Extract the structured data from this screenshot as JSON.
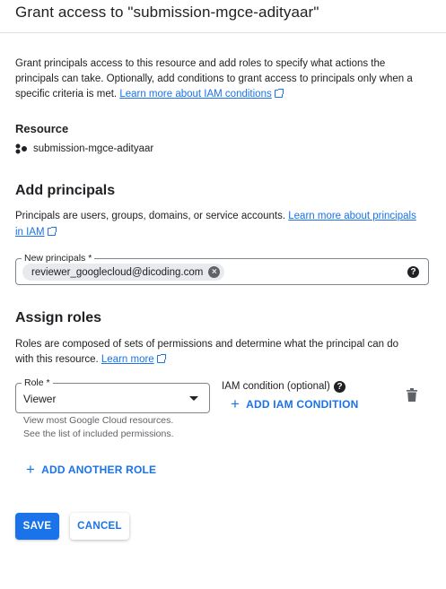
{
  "header": {
    "title": "Grant access to \"submission-mgce-adityaar\""
  },
  "intro": {
    "line1": "Grant principals access to this resource and add roles to specify what actions the",
    "line2": "principals can take. Optionally, add conditions to grant access to principals only when a",
    "line3_text": "specific criteria is met.",
    "link": "Learn more about IAM conditions"
  },
  "resource": {
    "heading": "Resource",
    "name": "submission-mgce-adityaar",
    "icon": "project-icon"
  },
  "add_principals": {
    "heading": "Add principals",
    "desc_text": "Principals are users, groups, domains, or service accounts.",
    "link_part1": "Learn more about principals",
    "link_part2": "in IAM",
    "field_label": "New principals *",
    "chip_value": "reviewer_googlecloud@dicoding.com",
    "chip_remove_icon": "cancel-icon",
    "help_icon": "help-icon"
  },
  "assign_roles": {
    "heading": "Assign roles",
    "desc_line1": "Roles are composed of sets of permissions and determine what the principal can do",
    "desc_line2_text": "with this resource.",
    "link": "Learn more",
    "role_label": "Role *",
    "role_value": "Viewer",
    "role_helper1": "View most Google Cloud resources.",
    "role_helper2": "See the list of included permissions.",
    "condition_label": "IAM condition (optional)",
    "add_condition": "ADD IAM CONDITION",
    "add_another_role": "ADD ANOTHER ROLE",
    "delete_icon": "trash-icon"
  },
  "actions": {
    "save": "SAVE",
    "cancel": "CANCEL"
  },
  "colors": {
    "primary": "#1a73e8",
    "text": "#202124",
    "muted": "#5f6368"
  }
}
